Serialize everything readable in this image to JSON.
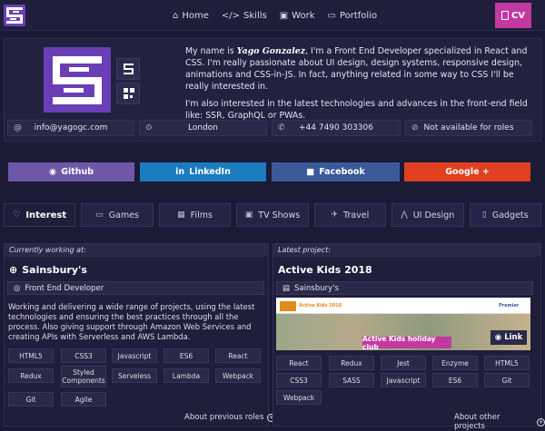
{
  "nav": {
    "items": [
      {
        "label": "Home",
        "icon": "home-icon"
      },
      {
        "label": "Skills",
        "icon": "code-icon"
      },
      {
        "label": "Work",
        "icon": "briefcase-icon"
      },
      {
        "label": "Portfolio",
        "icon": "folder-icon"
      }
    ],
    "cv_label": "CV"
  },
  "bio": {
    "prefix": "My name is ",
    "name": "Yago Gonzalez",
    "rest": ", I'm a Front End Developer specialized in React and CSS. I'm really passionate about UI design, design systems, responsive design, animations and CSS-in-JS. In fact, anything related in some way to CSS I'll be really interested in.",
    "p2": "I'm also interested in the latest technologies and advances in the front-end field like: SSR, GraphQL or PWAs."
  },
  "contacts": {
    "email": "info@yagogc.com",
    "location": "London",
    "phone": "+44 7490 303306",
    "availability": "Not available for roles"
  },
  "social": {
    "github": "Github",
    "linkedin": "LinkedIn",
    "facebook": "Facebook",
    "google": "Google +"
  },
  "tabs": [
    {
      "label": "Interest",
      "icon": "heart-icon"
    },
    {
      "label": "Games",
      "icon": "gamepad-icon"
    },
    {
      "label": "Films",
      "icon": "film-icon"
    },
    {
      "label": "TV Shows",
      "icon": "tv-icon"
    },
    {
      "label": "Travel",
      "icon": "plane-icon"
    },
    {
      "label": "UI Design",
      "icon": "compass-icon"
    },
    {
      "label": "Gadgets",
      "icon": "tablet-icon"
    }
  ],
  "current": {
    "header": "Currently working at:",
    "company": "Sainsbury's",
    "role": "Front End Developer",
    "description": "Working and delivering a wide range of projects, using the latest technologies and ensuring the best practices through all the process. Also giving support through Amazon Web Services and creating APIs with Serverless and AWS Lambda.",
    "tags": [
      "HTML5",
      "CSS3",
      "Javascript",
      "ES6",
      "React",
      "Redux",
      "Styled Components",
      "Serveless",
      "Lambda",
      "Webpack",
      "Git",
      "Agile"
    ],
    "footer": "About previous roles"
  },
  "project": {
    "header": "Latest project:",
    "title": "Active Kids 2018",
    "client": "Sainsbury's",
    "preview": {
      "site_name": "Active Kids 2018",
      "banner": "Active Kids holiday club",
      "link_label": "Link",
      "partner": "Premier"
    },
    "tags": [
      "React",
      "Redux",
      "Jest",
      "Enzyme",
      "HTML5",
      "CSS3",
      "SASS",
      "Javascript",
      "ES6",
      "Git",
      "Webpack"
    ],
    "footer": "About other projects"
  },
  "colors": {
    "background": "#1c1b36",
    "accent_purple": "#6a3fb5",
    "cv_pink": "#c23aa1",
    "github": "#6e57a8",
    "linkedin": "#1b7bbf",
    "facebook": "#3b5a9a",
    "google": "#e0401f"
  }
}
